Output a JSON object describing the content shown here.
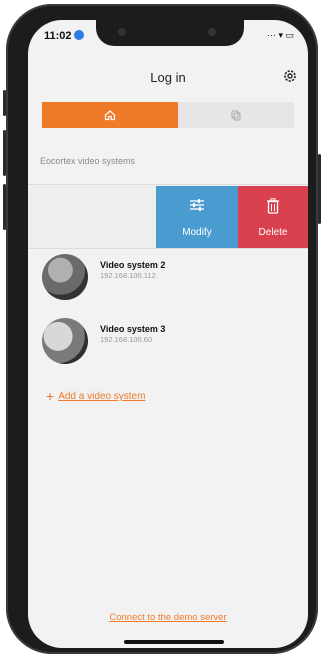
{
  "status_bar": {
    "time": "11:02"
  },
  "header": {
    "title": "Log in",
    "settings_icon": "gear-icon"
  },
  "tabs": [
    {
      "icon": "home-icon",
      "active": true
    },
    {
      "icon": "cloud-icon",
      "active": false
    }
  ],
  "colors": {
    "accent": "#ef7a29",
    "modify": "#4a9bd0",
    "delete": "#d9414f"
  },
  "section": {
    "label": "Eocortex video systems"
  },
  "swipe_actions": {
    "modify_label": "Modify",
    "delete_label": "Delete"
  },
  "video_systems": [
    {
      "name": "Video system 2",
      "ip": "192.168.100.112"
    },
    {
      "name": "Video system 3",
      "ip": "192.168.100.60"
    }
  ],
  "add_link": "Add a video system",
  "demo_link": "Connect to the demo server"
}
